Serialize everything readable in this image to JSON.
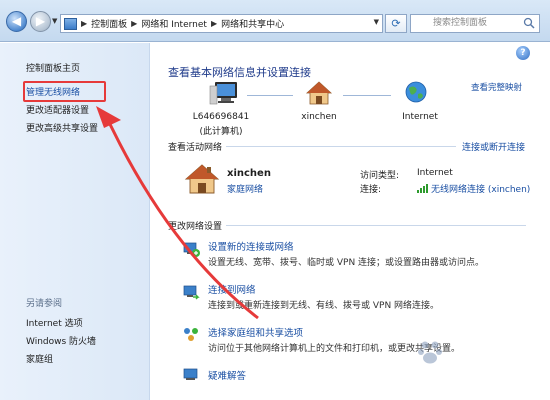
{
  "address": {
    "crumbs": [
      "控制面板",
      "网络和 Internet",
      "网络和共享中心"
    ],
    "search_placeholder": "搜索控制面板"
  },
  "sidebar": {
    "items": [
      {
        "label": "控制面板主页"
      },
      {
        "label": "管理无线网络"
      },
      {
        "label": "更改适配器设置"
      },
      {
        "label": "更改高级共享设置"
      }
    ],
    "see_also_title": "另请参阅",
    "see_also": [
      {
        "label": "Internet 选项"
      },
      {
        "label": "Windows 防火墙"
      },
      {
        "label": "家庭组"
      }
    ]
  },
  "main": {
    "title": "查看基本网络信息并设置连接",
    "view_full_map": "查看完整映射",
    "map": {
      "computer_name": "L646696841",
      "computer_sub": "(此计算机)",
      "network_name": "xinchen",
      "internet_label": "Internet"
    },
    "active_networks_title": "查看活动网络",
    "connect_disconnect": "连接或断开连接",
    "active_network": {
      "name": "xinchen",
      "type": "家庭网络",
      "access_type_label": "访问类型:",
      "access_type_value": "Internet",
      "connections_label": "连接:",
      "connections_value": "无线网络连接 (xinchen)"
    },
    "change_settings_title": "更改网络设置",
    "tasks": [
      {
        "link": "设置新的连接或网络",
        "desc": "设置无线、宽带、拨号、临时或 VPN 连接；或设置路由器或访问点。"
      },
      {
        "link": "连接到网络",
        "desc": "连接到或重新连接到无线、有线、拨号或 VPN 网络连接。"
      },
      {
        "link": "选择家庭组和共享选项",
        "desc": "访问位于其他网络计算机上的文件和打印机，或更改共享设置。"
      },
      {
        "link": "疑难解答",
        "desc": ""
      }
    ]
  },
  "colors": {
    "link": "#1a4fa3",
    "annotation": "#e63a3a"
  }
}
